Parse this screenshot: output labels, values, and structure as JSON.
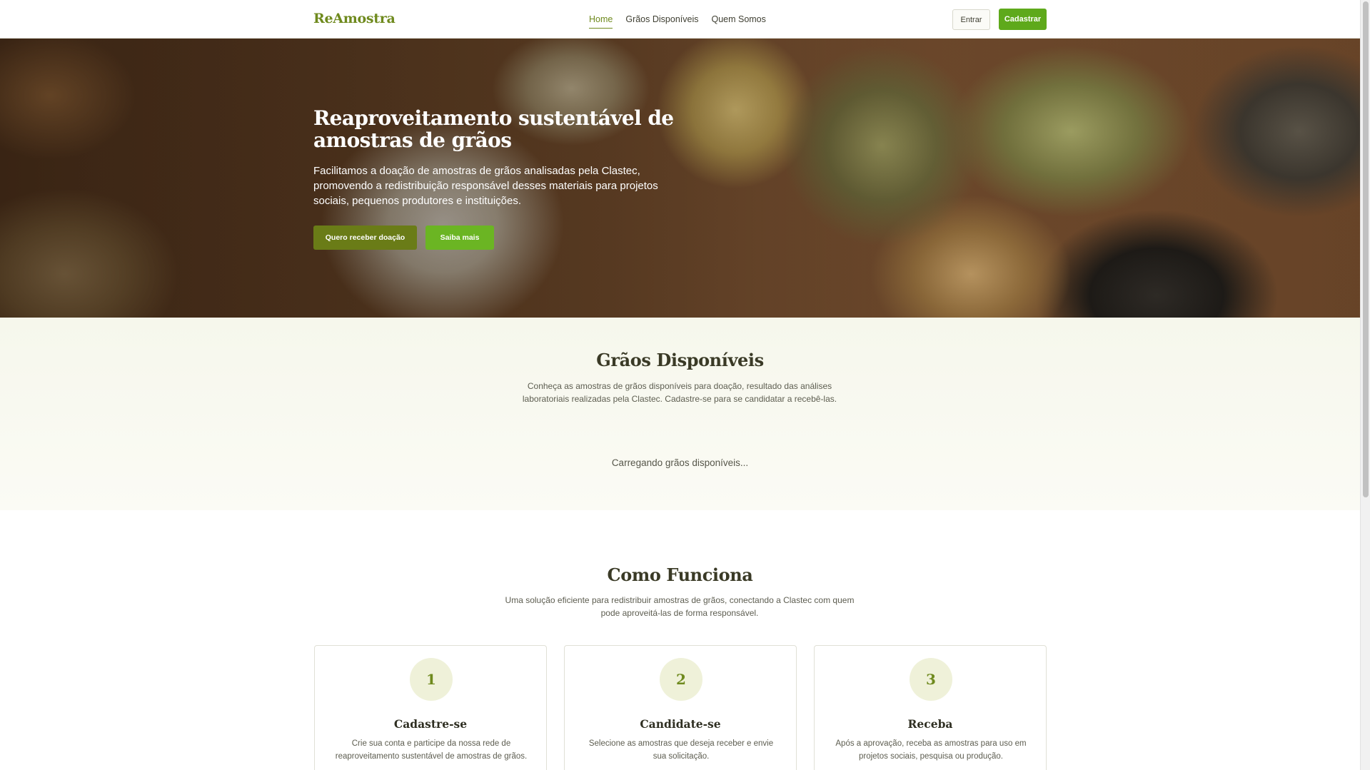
{
  "header": {
    "logo": "ReAmostra",
    "nav": [
      {
        "label": "Home",
        "active": true
      },
      {
        "label": "Grãos Disponíveis",
        "active": false
      },
      {
        "label": "Quem Somos",
        "active": false
      }
    ],
    "login_label": "Entrar",
    "signup_label": "Cadastrar"
  },
  "hero": {
    "title": "Reaproveitamento sustentável de amostras de grãos",
    "subtitle": "Facilitamos a doação de amostras de grãos analisadas pela Clastec, promovendo a redistribuição responsável desses materiais para projetos sociais, pequenos produtores e instituições.",
    "primary_button": "Quero receber doação",
    "secondary_button": "Saiba mais"
  },
  "grains_section": {
    "title": "Grãos Disponíveis",
    "subtitle": "Conheça as amostras de grãos disponíveis para doação, resultado das análises laboratoriais realizadas pela Clastec. Cadastre-se para se candidatar a recebê-las.",
    "loading_text": "Carregando grãos disponíveis..."
  },
  "how_section": {
    "title": "Como Funciona",
    "subtitle": "Uma solução eficiente para redistribuir amostras de grãos, conectando a Clastec com quem pode aproveitá-las de forma responsável.",
    "steps": [
      {
        "number": "1",
        "title": "Cadastre-se",
        "text": "Crie sua conta e participe da nossa rede de reaproveitamento sustentável de amostras de grãos."
      },
      {
        "number": "2",
        "title": "Candidate-se",
        "text": "Selecione as amostras que deseja receber e envie sua solicitação."
      },
      {
        "number": "3",
        "title": "Receba",
        "text": "Após a aprovação, receba as amostras para uso em projetos sociais, pesquisa ou produção."
      }
    ]
  },
  "colors": {
    "brand": "#6f8a1e",
    "accent_green": "#5ea91b",
    "olive_button": "#6a7c17"
  }
}
